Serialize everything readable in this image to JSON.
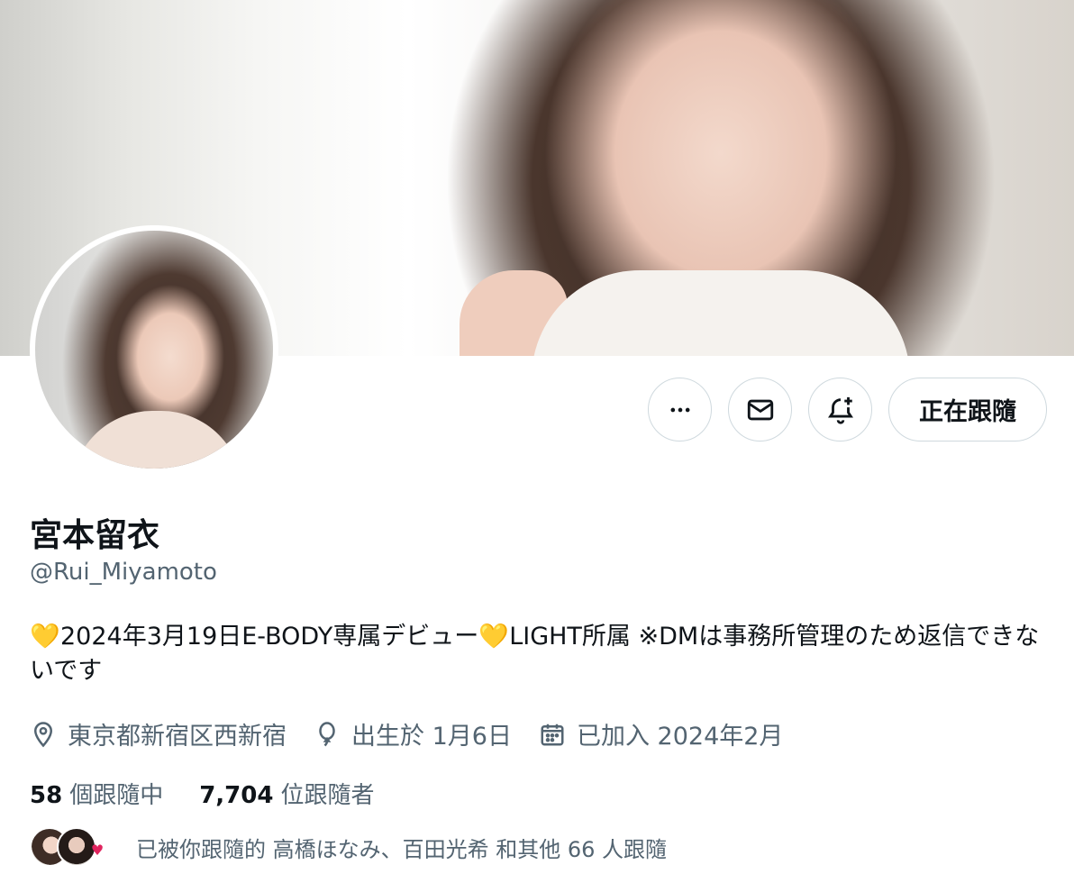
{
  "profile": {
    "name": "宮本留衣",
    "handle": "@Rui_Miyamoto",
    "bio_parts": [
      "2024年3月19日E-BODY専属デビュー",
      "LIGHT所属 ※DMは事務所管理のため返信できないです"
    ],
    "heart_glyph": "💛",
    "location": "東京都新宿区西新宿",
    "birthday": "出生於 1月6日",
    "joined": "已加入 2024年2月"
  },
  "actions": {
    "more_icon": "more-icon",
    "message_icon": "mail-icon",
    "notify_icon": "bell-plus-icon",
    "follow_label": "正在跟隨"
  },
  "stats": {
    "following_count": "58",
    "following_label": "個跟隨中",
    "followers_count": "7,704",
    "followers_label": "位跟隨者"
  },
  "followed_by": {
    "text": "已被你跟隨的 高橋ほなみ、百田光希 和其他 66 人跟隨"
  },
  "colors": {
    "secondary_text": "#536471",
    "border": "#cfd9de",
    "heart": "#f5c64f"
  }
}
